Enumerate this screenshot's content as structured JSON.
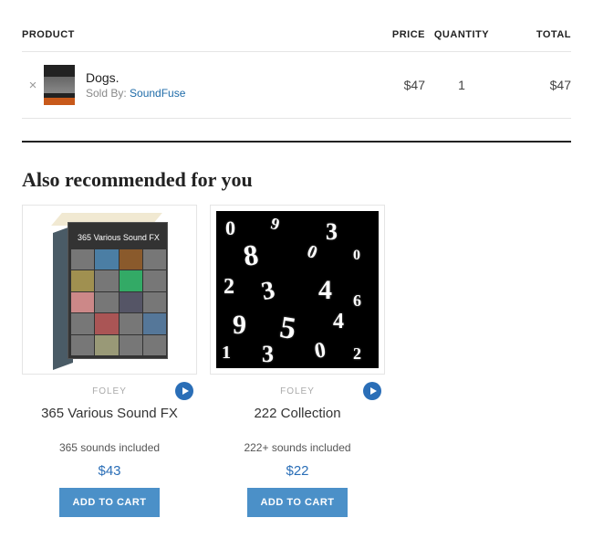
{
  "cart": {
    "headers": {
      "product": "PRODUCT",
      "price": "PRICE",
      "quantity": "QUANTITY",
      "total": "TOTAL"
    },
    "items": [
      {
        "name": "Dogs.",
        "sold_by_label": "Sold By: ",
        "vendor": "SoundFuse",
        "price": "$47",
        "quantity": "1",
        "total": "$47"
      }
    ]
  },
  "recommend": {
    "heading": "Also recommended for you",
    "items": [
      {
        "category": "FOLEY",
        "title": "365 Various Sound FX",
        "sounds": "365 sounds included",
        "price": "$43",
        "add_label": "ADD TO CART"
      },
      {
        "category": "FOLEY",
        "title": "222 Collection",
        "sounds": "222+ sounds included",
        "price": "$22",
        "add_label": "ADD TO CART"
      }
    ]
  }
}
